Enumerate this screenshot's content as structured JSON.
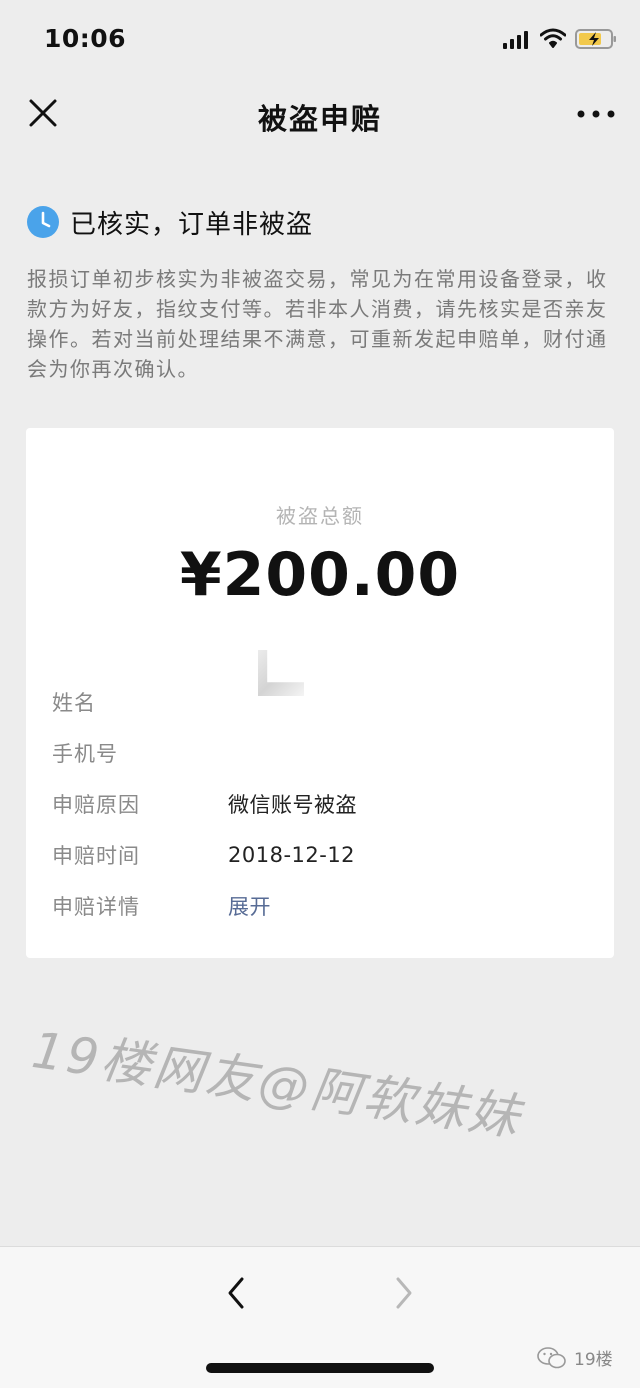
{
  "status_bar": {
    "time": "10:06"
  },
  "nav": {
    "title": "被盗申赔"
  },
  "status": {
    "heading": "已核实，订单非被盗",
    "description": "报损订单初步核实为非被盗交易，常见为在常用设备登录，收款方为好友，指纹支付等。若非本人消费，请先核实是否亲友操作。若对当前处理结果不满意，可重新发起申赔单，财付通会为你再次确认。"
  },
  "card": {
    "amount_label": "被盗总额",
    "amount_value": "¥200.00",
    "rows": [
      {
        "label": "姓名",
        "value": ""
      },
      {
        "label": "手机号",
        "value": ""
      },
      {
        "label": "申赔原因",
        "value": "微信账号被盗"
      },
      {
        "label": "申赔时间",
        "value": "2018-12-12"
      },
      {
        "label": "申赔详情",
        "value": "展开"
      }
    ]
  },
  "watermark": "19楼网友@阿软妹妹",
  "source_logo": "19楼",
  "colors": {
    "background": "#ededed",
    "card": "#ffffff",
    "link": "#576b95",
    "clock_icon": "#4aa3ea",
    "battery_fill": "#f2c94c"
  }
}
